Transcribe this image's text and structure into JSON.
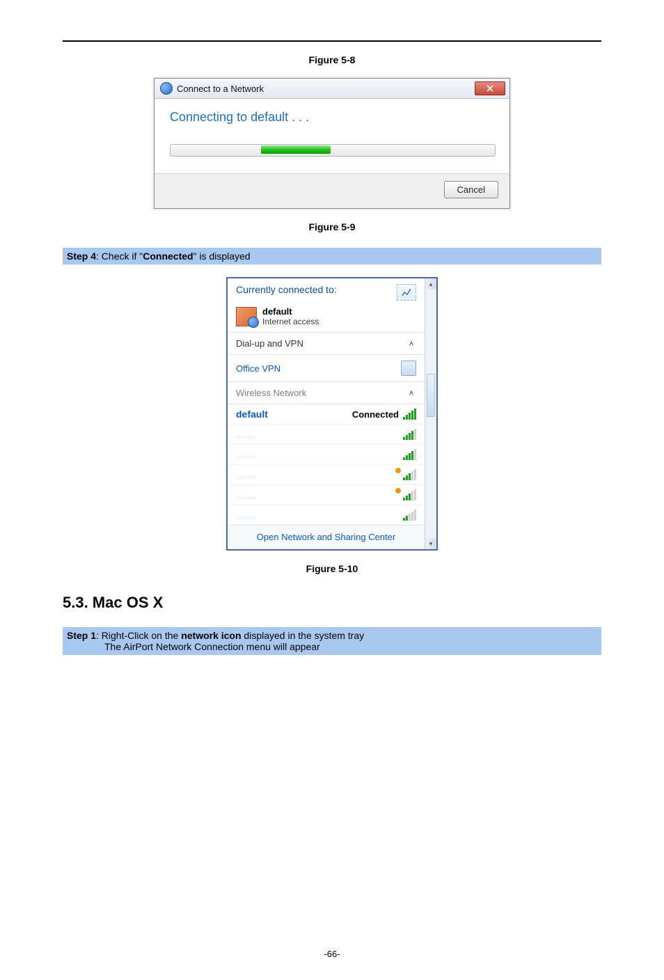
{
  "caption_5_8": "Figure 5-8",
  "caption_5_9": "Figure 5-9",
  "caption_5_10": "Figure 5-10",
  "dialog": {
    "title": "Connect to a Network",
    "message": "Connecting to default . . .",
    "cancel": "Cancel"
  },
  "step4": {
    "label": "Step 4",
    "before": ": Check if \"",
    "bold": "Connected",
    "after": "\" is displayed"
  },
  "flyout": {
    "currently": "Currently connected to:",
    "net_name": "default",
    "net_sub": "Internet access",
    "dialup": "Dial-up and VPN",
    "office": "Office VPN",
    "wireless": "Wireless Network",
    "connected_label": "Connected",
    "networks": [
      {
        "name": "default",
        "bold": true,
        "bars": 5,
        "secure": false,
        "connected": true
      },
      {
        "name": "……",
        "blur": true,
        "bars": 4,
        "secure": false
      },
      {
        "name": "……",
        "blur": true,
        "bars": 4,
        "secure": false
      },
      {
        "name": "……",
        "blur": true,
        "bars": 3,
        "secure": true
      },
      {
        "name": "……",
        "blur": true,
        "bars": 3,
        "secure": true
      },
      {
        "name": "……",
        "blur": true,
        "bars": 2,
        "secure": false
      }
    ],
    "footer": "Open Network and Sharing Center"
  },
  "section_5_3": "5.3.  Mac OS X",
  "step1": {
    "label": "Step 1",
    "line1_before": ": Right-Click on the ",
    "line1_bold": "network icon",
    "line1_after": " displayed in the system tray",
    "line2": "The AirPort Network Connection menu will appear"
  },
  "page_number": "-66-"
}
